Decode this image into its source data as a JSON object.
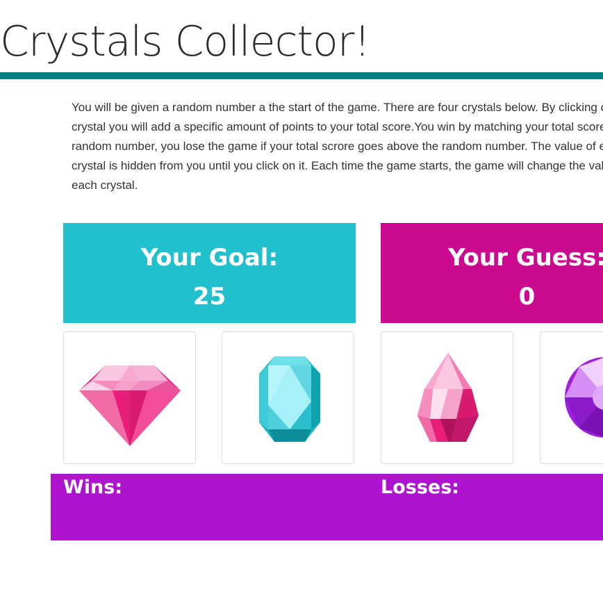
{
  "header": {
    "title": "Crystals Collector!"
  },
  "instructions": "You will be given a random number a the start of the game. There are four crystals below. By clicking on a crystal you will add a specific amount of points to your total score.You win by matching your total score to the random number, you lose the game if your total scrore goes above the random number. The value of each crystal is hidden from you until you click on it. Each time the game starts, the game will change the values of each crystal.",
  "goal": {
    "label": "Your Goal:",
    "value": "25",
    "color": "#20c0cc"
  },
  "guess": {
    "label": "Your Guess:",
    "value": "0",
    "color": "#cc0a90"
  },
  "crystals": [
    {
      "icon": "pink-diamond-icon",
      "color": "#e91e7a"
    },
    {
      "icon": "cyan-emerald-cut-gem-icon",
      "color": "#1fc6d2"
    },
    {
      "icon": "pink-teardrop-gem-icon",
      "color": "#e8337f"
    },
    {
      "icon": "purple-round-gem-icon",
      "color": "#a020e0"
    }
  ],
  "scoreboard": {
    "wins_label": "Wins:",
    "losses_label": "Losses:",
    "color": "#ae14cf"
  },
  "theme": {
    "rule_color": "#008080"
  }
}
